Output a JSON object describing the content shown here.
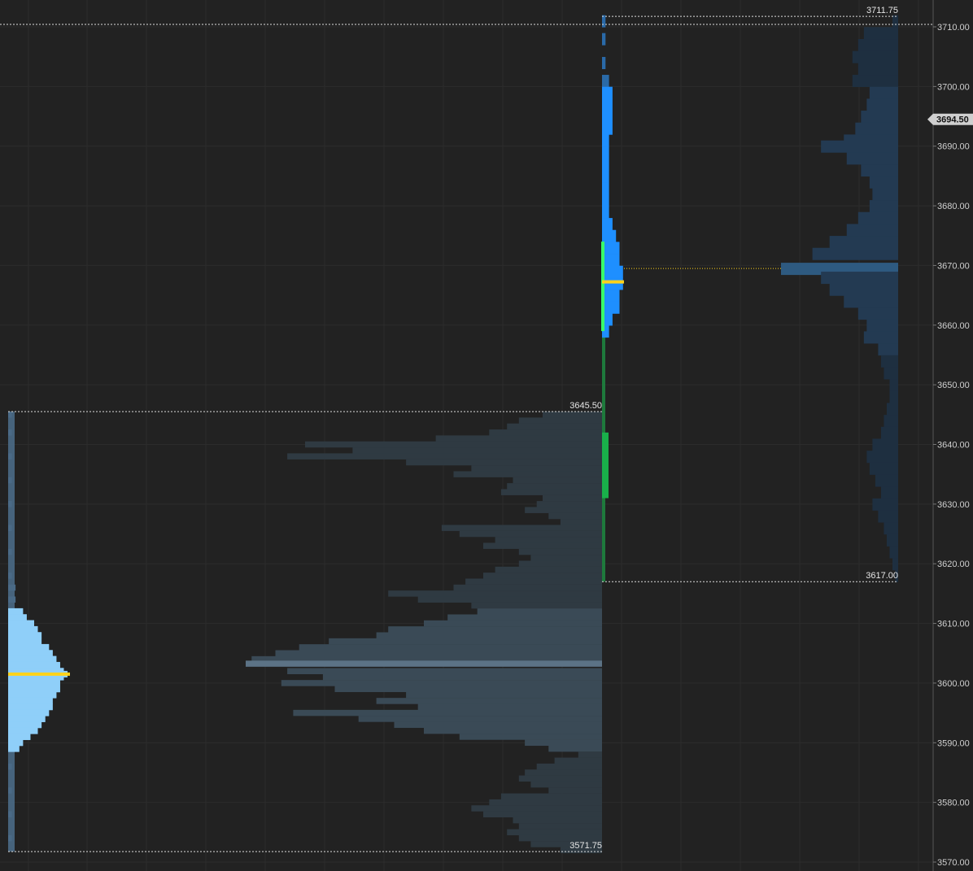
{
  "chart_data": {
    "type": "bar",
    "description_type": "market-profile",
    "y_range": [
      3570,
      3713
    ],
    "y_ticks": [
      "3570.00",
      "3580.00",
      "3590.00",
      "3600.00",
      "3610.00",
      "3620.00",
      "3630.00",
      "3640.00",
      "3650.00",
      "3660.00",
      "3670.00",
      "3680.00",
      "3690.00",
      "3700.00",
      "3710.00"
    ],
    "current_price": "3694.50",
    "levels": [
      {
        "label": "3711.75",
        "price": 3711.75
      },
      {
        "label": "3645.50",
        "price": 3645.5
      },
      {
        "label": "3617.00",
        "price": 3617.0
      },
      {
        "label": "3571.75",
        "price": 3571.75
      }
    ],
    "profiles": [
      {
        "name_key": "prior-session",
        "high": 3645.5,
        "low": 3571.75,
        "poc_price": 3603.25,
        "value_area": [
          3589,
          3612
        ],
        "tpo_poc_price": 3601.5,
        "volume_histogram": [
          {
            "price": 3645,
            "volume": 10
          },
          {
            "price": 3644,
            "volume": 14
          },
          {
            "price": 3643,
            "volume": 16
          },
          {
            "price": 3642,
            "volume": 19
          },
          {
            "price": 3641,
            "volume": 28
          },
          {
            "price": 3640,
            "volume": 50
          },
          {
            "price": 3639,
            "volume": 42
          },
          {
            "price": 3638,
            "volume": 53
          },
          {
            "price": 3637,
            "volume": 33
          },
          {
            "price": 3636,
            "volume": 22
          },
          {
            "price": 3635,
            "volume": 25
          },
          {
            "price": 3634,
            "volume": 15
          },
          {
            "price": 3633,
            "volume": 16
          },
          {
            "price": 3632,
            "volume": 17
          },
          {
            "price": 3631,
            "volume": 10
          },
          {
            "price": 3630,
            "volume": 11
          },
          {
            "price": 3629,
            "volume": 13
          },
          {
            "price": 3628,
            "volume": 9
          },
          {
            "price": 3627,
            "volume": 7
          },
          {
            "price": 3626,
            "volume": 27
          },
          {
            "price": 3625,
            "volume": 24
          },
          {
            "price": 3624,
            "volume": 18
          },
          {
            "price": 3623,
            "volume": 20
          },
          {
            "price": 3622,
            "volume": 14
          },
          {
            "price": 3621,
            "volume": 12
          },
          {
            "price": 3620,
            "volume": 14
          },
          {
            "price": 3619,
            "volume": 18
          },
          {
            "price": 3618,
            "volume": 20
          },
          {
            "price": 3617,
            "volume": 23
          },
          {
            "price": 3616,
            "volume": 25
          },
          {
            "price": 3615,
            "volume": 36
          },
          {
            "price": 3614,
            "volume": 31
          },
          {
            "price": 3613,
            "volume": 22
          },
          {
            "price": 3612,
            "volume": 21
          },
          {
            "price": 3611,
            "volume": 26
          },
          {
            "price": 3610,
            "volume": 30
          },
          {
            "price": 3609,
            "volume": 36
          },
          {
            "price": 3608,
            "volume": 38
          },
          {
            "price": 3607,
            "volume": 46
          },
          {
            "price": 3606,
            "volume": 51
          },
          {
            "price": 3605,
            "volume": 55
          },
          {
            "price": 3604,
            "volume": 59
          },
          {
            "price": 3603.25,
            "volume": 60
          },
          {
            "price": 3602,
            "volume": 53
          },
          {
            "price": 3601,
            "volume": 47
          },
          {
            "price": 3600,
            "volume": 54
          },
          {
            "price": 3599,
            "volume": 45
          },
          {
            "price": 3598,
            "volume": 33
          },
          {
            "price": 3597,
            "volume": 38
          },
          {
            "price": 3596,
            "volume": 31
          },
          {
            "price": 3595,
            "volume": 52
          },
          {
            "price": 3594,
            "volume": 41
          },
          {
            "price": 3593,
            "volume": 35
          },
          {
            "price": 3592,
            "volume": 30
          },
          {
            "price": 3591,
            "volume": 24
          },
          {
            "price": 3590,
            "volume": 13
          },
          {
            "price": 3589,
            "volume": 9
          },
          {
            "price": 3588,
            "volume": 4
          },
          {
            "price": 3587,
            "volume": 8
          },
          {
            "price": 3586,
            "volume": 11
          },
          {
            "price": 3585,
            "volume": 13
          },
          {
            "price": 3584,
            "volume": 14
          },
          {
            "price": 3583,
            "volume": 12
          },
          {
            "price": 3582,
            "volume": 9
          },
          {
            "price": 3581,
            "volume": 17
          },
          {
            "price": 3580,
            "volume": 19
          },
          {
            "price": 3579,
            "volume": 22
          },
          {
            "price": 3578,
            "volume": 20
          },
          {
            "price": 3577,
            "volume": 15
          },
          {
            "price": 3576,
            "volume": 14
          },
          {
            "price": 3575,
            "volume": 16
          },
          {
            "price": 3574,
            "volume": 14
          },
          {
            "price": 3573,
            "volume": 12
          },
          {
            "price": 3572,
            "volume": 7
          }
        ],
        "tpo_histogram": [
          {
            "price": 3645,
            "count": 1
          },
          {
            "price": 3642,
            "count": 1
          },
          {
            "price": 3638,
            "count": 1
          },
          {
            "price": 3634,
            "count": 1
          },
          {
            "price": 3630,
            "count": 1
          },
          {
            "price": 3626,
            "count": 1
          },
          {
            "price": 3622,
            "count": 1
          },
          {
            "price": 3618,
            "count": 1
          },
          {
            "price": 3616,
            "count": 2
          },
          {
            "price": 3614,
            "count": 2
          },
          {
            "price": 3612,
            "count": 4
          },
          {
            "price": 3611,
            "count": 5
          },
          {
            "price": 3610,
            "count": 7
          },
          {
            "price": 3609,
            "count": 8
          },
          {
            "price": 3608,
            "count": 9
          },
          {
            "price": 3607,
            "count": 9
          },
          {
            "price": 3606,
            "count": 11
          },
          {
            "price": 3605,
            "count": 12
          },
          {
            "price": 3604,
            "count": 13
          },
          {
            "price": 3603,
            "count": 14
          },
          {
            "price": 3602,
            "count": 15
          },
          {
            "price": 3601.5,
            "count": 16
          },
          {
            "price": 3601,
            "count": 15
          },
          {
            "price": 3600,
            "count": 14
          },
          {
            "price": 3599,
            "count": 14
          },
          {
            "price": 3598,
            "count": 13
          },
          {
            "price": 3597,
            "count": 12
          },
          {
            "price": 3596,
            "count": 12
          },
          {
            "price": 3595,
            "count": 11
          },
          {
            "price": 3594,
            "count": 10
          },
          {
            "price": 3593,
            "count": 9
          },
          {
            "price": 3592,
            "count": 8
          },
          {
            "price": 3591,
            "count": 6
          },
          {
            "price": 3590,
            "count": 4
          },
          {
            "price": 3589,
            "count": 3
          },
          {
            "price": 3586,
            "count": 1
          },
          {
            "price": 3582,
            "count": 1
          },
          {
            "price": 3578,
            "count": 1
          },
          {
            "price": 3574,
            "count": 1
          }
        ]
      },
      {
        "name_key": "current-session",
        "high": 3711.75,
        "low": 3617.0,
        "poc_price": 3669.5,
        "value_area": [
          3655,
          3700
        ],
        "tpo_poc_price": 3667.25,
        "initial_balance": [
          3659,
          3674
        ],
        "volume_histogram": [
          {
            "price": 3711,
            "volume": 2
          },
          {
            "price": 3709,
            "volume": 12
          },
          {
            "price": 3707,
            "volume": 14
          },
          {
            "price": 3705,
            "volume": 16
          },
          {
            "price": 3703,
            "volume": 14
          },
          {
            "price": 3701,
            "volume": 16
          },
          {
            "price": 3699,
            "volume": 10
          },
          {
            "price": 3697,
            "volume": 11
          },
          {
            "price": 3695,
            "volume": 13
          },
          {
            "price": 3693,
            "volume": 15
          },
          {
            "price": 3691,
            "volume": 19
          },
          {
            "price": 3690,
            "volume": 27
          },
          {
            "price": 3688,
            "volume": 18
          },
          {
            "price": 3686,
            "volume": 13
          },
          {
            "price": 3684,
            "volume": 10
          },
          {
            "price": 3682,
            "volume": 9
          },
          {
            "price": 3680,
            "volume": 10
          },
          {
            "price": 3678,
            "volume": 14
          },
          {
            "price": 3676,
            "volume": 18
          },
          {
            "price": 3674,
            "volume": 24
          },
          {
            "price": 3672,
            "volume": 30
          },
          {
            "price": 3669.5,
            "volume": 41
          },
          {
            "price": 3668,
            "volume": 27
          },
          {
            "price": 3666,
            "volume": 24
          },
          {
            "price": 3664,
            "volume": 19
          },
          {
            "price": 3662,
            "volume": 14
          },
          {
            "price": 3660,
            "volume": 11
          },
          {
            "price": 3658,
            "volume": 12
          },
          {
            "price": 3656,
            "volume": 7
          },
          {
            "price": 3654,
            "volume": 6
          },
          {
            "price": 3652,
            "volume": 5
          },
          {
            "price": 3650,
            "volume": 3
          },
          {
            "price": 3648,
            "volume": 3
          },
          {
            "price": 3646,
            "volume": 4
          },
          {
            "price": 3644,
            "volume": 5
          },
          {
            "price": 3642,
            "volume": 6
          },
          {
            "price": 3640,
            "volume": 9
          },
          {
            "price": 3638,
            "volume": 11
          },
          {
            "price": 3636,
            "volume": 10
          },
          {
            "price": 3634,
            "volume": 8
          },
          {
            "price": 3632,
            "volume": 6
          },
          {
            "price": 3630,
            "volume": 9
          },
          {
            "price": 3628,
            "volume": 7
          },
          {
            "price": 3626,
            "volume": 5
          },
          {
            "price": 3624,
            "volume": 4
          },
          {
            "price": 3622,
            "volume": 3
          },
          {
            "price": 3620,
            "volume": 2
          },
          {
            "price": 3618,
            "volume": 1
          }
        ],
        "tpo_histogram": [
          {
            "price": 3711,
            "count": 1
          },
          {
            "price": 3708,
            "count": 1
          },
          {
            "price": 3704,
            "count": 1
          },
          {
            "price": 3701,
            "count": 2
          },
          {
            "price": 3699,
            "count": 3
          },
          {
            "price": 3697,
            "count": 3
          },
          {
            "price": 3695,
            "count": 3
          },
          {
            "price": 3693,
            "count": 3
          },
          {
            "price": 3691,
            "count": 2
          },
          {
            "price": 3689,
            "count": 2
          },
          {
            "price": 3687,
            "count": 2
          },
          {
            "price": 3685,
            "count": 2
          },
          {
            "price": 3683,
            "count": 2
          },
          {
            "price": 3681,
            "count": 2
          },
          {
            "price": 3679,
            "count": 2
          },
          {
            "price": 3677,
            "count": 3
          },
          {
            "price": 3675,
            "count": 4
          },
          {
            "price": 3673,
            "count": 5
          },
          {
            "price": 3671,
            "count": 5
          },
          {
            "price": 3669,
            "count": 6
          },
          {
            "price": 3667,
            "count": 6
          },
          {
            "price": 3665,
            "count": 5
          },
          {
            "price": 3663,
            "count": 5
          },
          {
            "price": 3661,
            "count": 3
          },
          {
            "price": 3659,
            "count": 2
          }
        ],
        "single_prints": [
          {
            "from": 3617,
            "to": 3659,
            "style": "dim"
          },
          {
            "from": 3631,
            "to": 3642,
            "style": "bright"
          }
        ]
      }
    ],
    "colors": {
      "background": "#222222",
      "grid": "#2c2c2c",
      "prior_volume": "#2f3a42",
      "prior_volume_va": "#3a4a56",
      "prior_poc": "#5c7386",
      "prior_tpo": "#4a6a86",
      "prior_tpo_va": "#8fcff9",
      "current_volume": "#1e2f40",
      "current_volume_va": "#233a52",
      "current_poc": "#2e5a80",
      "current_tpo": "#1e8fff",
      "current_tpo_dim": "#2a6aa8",
      "ib": "#39ff6a",
      "single_dim": "#1e7a3c",
      "single_bright": "#19b04a",
      "poc_line": "#ffd21a",
      "level_line": "#dddddd",
      "axis_text": "#cfcfcf",
      "price_tag": "#cfcfcf"
    }
  }
}
